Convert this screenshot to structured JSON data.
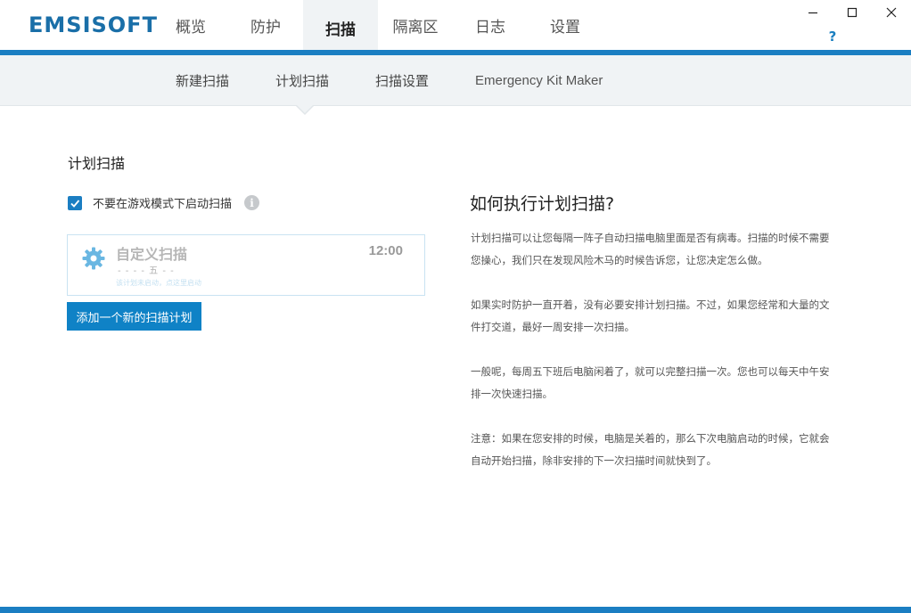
{
  "app": {
    "logo": "EMSISOFT",
    "help_label": "?"
  },
  "main_tabs": [
    {
      "label": "概览"
    },
    {
      "label": "防护"
    },
    {
      "label": "扫描",
      "active": true
    },
    {
      "label": "隔离区"
    },
    {
      "label": "日志"
    },
    {
      "label": "设置"
    }
  ],
  "sub_tabs": [
    {
      "label": "新建扫描"
    },
    {
      "label": "计划扫描",
      "active": true
    },
    {
      "label": "扫描设置"
    },
    {
      "label": "Emergency Kit Maker"
    }
  ],
  "schedule": {
    "section_title": "计划扫描",
    "game_mode_checkbox": {
      "label": "不要在游戏模式下启动扫描",
      "checked": true
    },
    "card": {
      "title": "自定义扫描",
      "time": "12:00",
      "days": "- - - - 五 - -",
      "note": "该计划未启动，点这里启动"
    },
    "add_button": "添加一个新的扫描计划"
  },
  "help": {
    "title": "如何执行计划扫描?",
    "paragraphs": [
      "计划扫描可以让您每隔一阵子自动扫描电脑里面是否有病毒。扫描的时候不需要您操心，我们只在发现风险木马的时候告诉您，让您决定怎么做。",
      "如果实时防护一直开着，没有必要安排计划扫描。不过，如果您经常和大量的文件打交道，最好一周安排一次扫描。",
      "一般呢，每周五下班后电脑闲着了，就可以完整扫描一次。您也可以每天中午安排一次快速扫描。",
      "注意：如果在您安排的时候，电脑是关着的，那么下次电脑启动的时候，它就会自动开始扫描，除非安排的下一次扫描时间就快到了。"
    ]
  },
  "colors": {
    "accent": "#1b7ec2",
    "logo": "#1a6fa8",
    "subnav_bg": "#f0f3f5"
  }
}
